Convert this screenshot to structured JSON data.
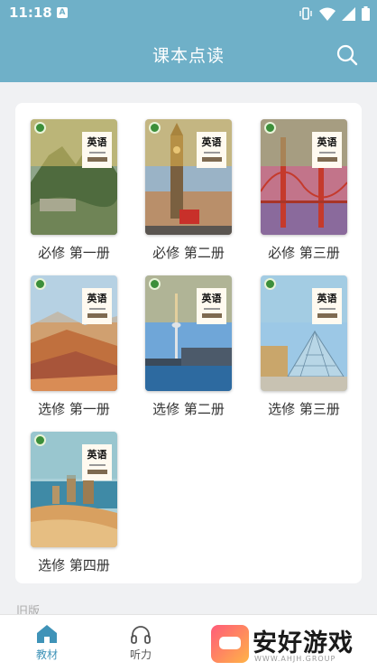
{
  "status_bar": {
    "time": "11:18",
    "notification_letter": "A",
    "icons": [
      "vibrate-icon",
      "wifi-icon",
      "signal-icon",
      "battery-icon"
    ]
  },
  "app_bar": {
    "title": "课本点读",
    "search_icon": "search-icon"
  },
  "books": [
    {
      "label": "必修 第一册",
      "cover_title": "英语",
      "band_color": "#e0c36a",
      "scene": "mountain-ruins"
    },
    {
      "label": "必修 第二册",
      "cover_title": "英语",
      "band_color": "#e8b84a",
      "scene": "big-ben"
    },
    {
      "label": "必修 第三册",
      "cover_title": "英语",
      "band_color": "#8fbf7a",
      "scene": "golden-gate"
    },
    {
      "label": "选修 第一册",
      "cover_title": "英语",
      "band_color": "#b5cfe0",
      "scene": "rainbow-hills"
    },
    {
      "label": "选修 第二册",
      "cover_title": "英语",
      "band_color": "#e6c060",
      "scene": "cn-tower"
    },
    {
      "label": "选修 第三册",
      "cover_title": "英语",
      "band_color": "#a9cfe0",
      "scene": "louvre"
    },
    {
      "label": "选修 第四册",
      "cover_title": "英语",
      "band_color": "#8cc0c8",
      "scene": "coast"
    }
  ],
  "old_version_label": "旧版",
  "tabs": [
    {
      "label": "教材",
      "icon": "home-icon",
      "active": true
    },
    {
      "label": "听力",
      "icon": "headphones-icon",
      "active": false
    }
  ],
  "colors": {
    "primary": "#6fb0c8",
    "tab_active": "#3f93b8",
    "tab_inactive": "#555555"
  },
  "watermark": {
    "text": "安好游戏",
    "subtext": "WWW.AHJH.GROUP"
  }
}
